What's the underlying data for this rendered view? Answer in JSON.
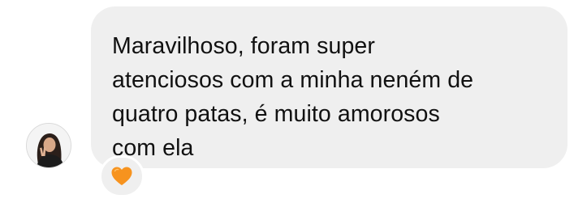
{
  "message": {
    "text": "Maravilhoso, foram super\natenciosos com a minha neném de\nquatro patas, é muito amorosos\ncom ela"
  },
  "reaction": {
    "icon": "orange-heart-icon",
    "color": "#f7931e"
  },
  "sender": {
    "avatar_icon": "user-avatar"
  },
  "colors": {
    "bubble": "#efefef",
    "text": "#111111"
  }
}
